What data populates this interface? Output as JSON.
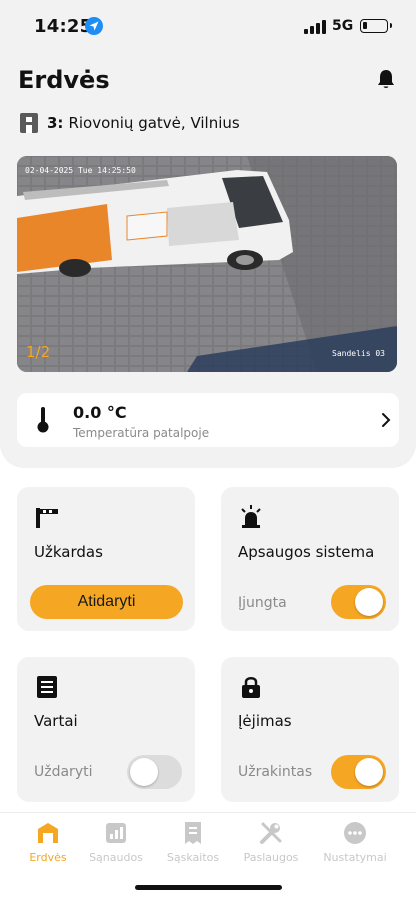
{
  "status_bar": {
    "time": "14:25",
    "network": "5G"
  },
  "header": {
    "title": "Erdvės"
  },
  "site": {
    "number": "3:",
    "address": "Riovonių gatvė, Vilnius"
  },
  "camera": {
    "timestamp": "02-04-2025 Tue 14:25:50",
    "label": "Sandelis 03",
    "pager": "1/2"
  },
  "temperature": {
    "value": "0.0 °C",
    "label": "Temperatūra patalpoje"
  },
  "cards": {
    "barrier": {
      "name": "Užkardas",
      "action": "Atidaryti"
    },
    "alarm": {
      "name": "Apsaugos sistema",
      "state": "Įjungta",
      "on": true
    },
    "gate": {
      "name": "Vartai",
      "state": "Uždaryti",
      "on": false
    },
    "entry": {
      "name": "Įėjimas",
      "state": "Užrakintas",
      "on": true
    }
  },
  "tabs": [
    {
      "label": "Erdvės",
      "icon": "garage-icon",
      "active": true
    },
    {
      "label": "Sąnaudos",
      "icon": "bar-chart-icon",
      "active": false
    },
    {
      "label": "Sąskaitos",
      "icon": "receipt-icon",
      "active": false
    },
    {
      "label": "Paslaugos",
      "icon": "tools-icon",
      "active": false
    },
    {
      "label": "Nustatymai",
      "icon": "more-icon",
      "active": false
    }
  ],
  "colors": {
    "accent": "#f5a623",
    "card_bg": "#f2f2f2",
    "inactive": "#c8c8c8"
  }
}
